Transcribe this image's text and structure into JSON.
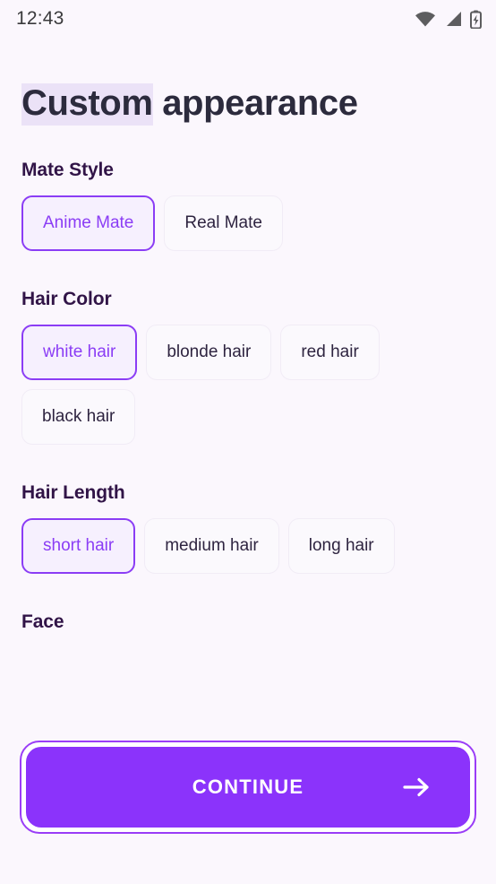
{
  "status_bar": {
    "time": "12:43",
    "icons": [
      "wifi-icon",
      "cellular-signal-icon",
      "battery-charging-icon"
    ]
  },
  "page": {
    "title_highlight": "Custom",
    "title_rest": " appearance"
  },
  "theme": {
    "background": "#fbf7fd",
    "accent": "#8b33fb",
    "accent_border": "#8b3df5",
    "selected_chip_bg": "#f6f0fe",
    "chip_bg": "#fbf9fd",
    "chip_border": "#f1ecf6",
    "heading_color": "#311447",
    "title_color": "#2c2b3d",
    "title_highlight_bg": "#ebe2f7"
  },
  "sections": [
    {
      "title": "Mate Style",
      "options": [
        {
          "label": "Anime Mate",
          "selected": true
        },
        {
          "label": "Real Mate",
          "selected": false
        }
      ]
    },
    {
      "title": "Hair Color",
      "options": [
        {
          "label": "white hair",
          "selected": true
        },
        {
          "label": "blonde hair",
          "selected": false
        },
        {
          "label": "red hair",
          "selected": false
        },
        {
          "label": "black hair",
          "selected": false
        }
      ]
    },
    {
      "title": "Hair Length",
      "options": [
        {
          "label": "short hair",
          "selected": true
        },
        {
          "label": "medium hair",
          "selected": false
        },
        {
          "label": "long hair",
          "selected": false
        }
      ]
    },
    {
      "title": "Face",
      "options": []
    }
  ],
  "cta": {
    "label": "CONTINUE",
    "icon": "arrow-right-icon"
  }
}
